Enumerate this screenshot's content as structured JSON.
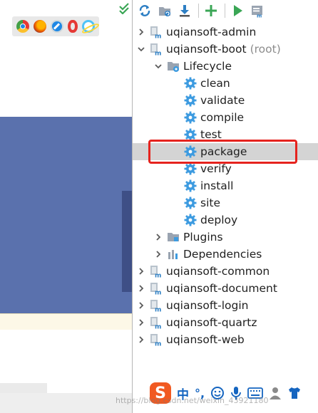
{
  "browsers": [
    "chrome-icon",
    "firefox-icon",
    "safari-icon",
    "opera-icon",
    "ie-icon"
  ],
  "toolbar": {
    "icons": [
      "refresh-icon",
      "reimport-icon",
      "download-icon",
      "add-icon",
      "run-icon",
      "execute-goal-icon"
    ]
  },
  "tree": [
    {
      "label": "uqiansoft-admin",
      "suffix": "",
      "level": 0,
      "icon": "maven-module-icon",
      "arrow": "right"
    },
    {
      "label": "uqiansoft-boot",
      "suffix": "(root)",
      "level": 0,
      "icon": "maven-module-icon",
      "arrow": "down"
    },
    {
      "label": "Lifecycle",
      "suffix": "",
      "level": 1,
      "icon": "lifecycle-folder-icon",
      "arrow": "down"
    },
    {
      "label": "clean",
      "suffix": "",
      "level": 2,
      "icon": "gear-icon",
      "arrow": "none"
    },
    {
      "label": "validate",
      "suffix": "",
      "level": 2,
      "icon": "gear-icon",
      "arrow": "none"
    },
    {
      "label": "compile",
      "suffix": "",
      "level": 2,
      "icon": "gear-icon",
      "arrow": "none"
    },
    {
      "label": "test",
      "suffix": "",
      "level": 2,
      "icon": "gear-icon",
      "arrow": "none"
    },
    {
      "label": "package",
      "suffix": "",
      "level": 2,
      "icon": "gear-icon",
      "arrow": "none",
      "selected": true
    },
    {
      "label": "verify",
      "suffix": "",
      "level": 2,
      "icon": "gear-icon",
      "arrow": "none"
    },
    {
      "label": "install",
      "suffix": "",
      "level": 2,
      "icon": "gear-icon",
      "arrow": "none"
    },
    {
      "label": "site",
      "suffix": "",
      "level": 2,
      "icon": "gear-icon",
      "arrow": "none"
    },
    {
      "label": "deploy",
      "suffix": "",
      "level": 2,
      "icon": "gear-icon",
      "arrow": "none"
    },
    {
      "label": "Plugins",
      "suffix": "",
      "level": 1,
      "icon": "plugins-folder-icon",
      "arrow": "right"
    },
    {
      "label": "Dependencies",
      "suffix": "",
      "level": 1,
      "icon": "dependencies-icon",
      "arrow": "right"
    },
    {
      "label": "uqiansoft-common",
      "suffix": "",
      "level": 0,
      "icon": "maven-module-icon",
      "arrow": "right"
    },
    {
      "label": "uqiansoft-document",
      "suffix": "",
      "level": 0,
      "icon": "maven-module-icon",
      "arrow": "right"
    },
    {
      "label": "uqiansoft-login",
      "suffix": "",
      "level": 0,
      "icon": "maven-module-icon",
      "arrow": "right"
    },
    {
      "label": "uqiansoft-quartz",
      "suffix": "",
      "level": 0,
      "icon": "maven-module-icon",
      "arrow": "right"
    },
    {
      "label": "uqiansoft-web",
      "suffix": "",
      "level": 0,
      "icon": "maven-module-icon",
      "arrow": "right"
    }
  ],
  "ime": {
    "logo": "S",
    "mode": "中",
    "punct": "°,",
    "icons": [
      "emoji-icon",
      "microphone-icon",
      "keyboard-icon",
      "user-icon",
      "shirt-icon"
    ]
  },
  "watermark": "https://blog.csdn.net/weixin_43921180",
  "colors": {
    "accent_blue": "#5a71ad",
    "gear_blue": "#3d9be0",
    "selection": "#d4d4d4",
    "highlight_red": "#e5231e",
    "ime_orange": "#f15a22"
  }
}
